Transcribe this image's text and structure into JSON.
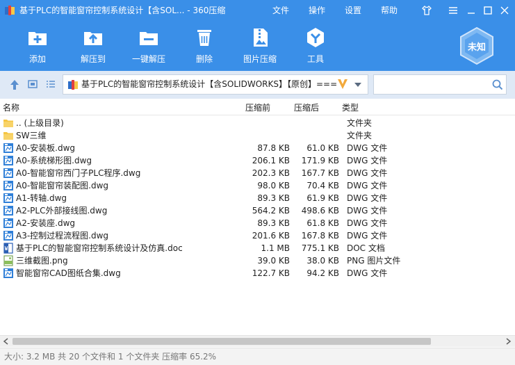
{
  "window": {
    "title": "基于PLC的智能窗帘控制系统设计【含SOL... - 360压缩",
    "menu": [
      "文件",
      "操作",
      "设置",
      "帮助"
    ]
  },
  "toolbar": {
    "buttons": [
      {
        "label": "添加",
        "icon": "add-icon"
      },
      {
        "label": "解压到",
        "icon": "extract-to-icon"
      },
      {
        "label": "一键解压",
        "icon": "one-click-extract-icon"
      },
      {
        "label": "删除",
        "icon": "delete-icon"
      },
      {
        "label": "图片压缩",
        "icon": "image-compress-icon"
      },
      {
        "label": "工具",
        "icon": "tools-icon"
      }
    ],
    "badge": "未知"
  },
  "address": {
    "path": "基于PLC的智能窗帘控制系统设计【含SOLIDWORKS】【原创】===",
    "search_placeholder": ""
  },
  "columns": [
    "名称",
    "压缩前",
    "压缩后",
    "类型"
  ],
  "files": [
    {
      "name": ".. (上级目录)",
      "orig": "",
      "comp": "",
      "type": "文件夹",
      "kind": "folder"
    },
    {
      "name": "SW三维",
      "orig": "",
      "comp": "",
      "type": "文件夹",
      "kind": "folder"
    },
    {
      "name": "A0-安装板.dwg",
      "orig": "87.8 KB",
      "comp": "61.0 KB",
      "type": "DWG 文件",
      "kind": "dwg"
    },
    {
      "name": "A0-系统梯形图.dwg",
      "orig": "206.1 KB",
      "comp": "171.9 KB",
      "type": "DWG 文件",
      "kind": "dwg"
    },
    {
      "name": "A0-智能窗帘西门子PLC程序.dwg",
      "orig": "202.3 KB",
      "comp": "167.7 KB",
      "type": "DWG 文件",
      "kind": "dwg"
    },
    {
      "name": "A0-智能窗帘装配图.dwg",
      "orig": "98.0 KB",
      "comp": "70.4 KB",
      "type": "DWG 文件",
      "kind": "dwg"
    },
    {
      "name": "A1-转轴.dwg",
      "orig": "89.3 KB",
      "comp": "61.9 KB",
      "type": "DWG 文件",
      "kind": "dwg"
    },
    {
      "name": "A2-PLC外部接线图.dwg",
      "orig": "564.2 KB",
      "comp": "498.6 KB",
      "type": "DWG 文件",
      "kind": "dwg"
    },
    {
      "name": "A2-安装座.dwg",
      "orig": "89.3 KB",
      "comp": "61.8 KB",
      "type": "DWG 文件",
      "kind": "dwg"
    },
    {
      "name": "A3-控制过程流程图.dwg",
      "orig": "201.6 KB",
      "comp": "167.8 KB",
      "type": "DWG 文件",
      "kind": "dwg"
    },
    {
      "name": "基于PLC的智能窗帘控制系统设计及仿真.doc",
      "orig": "1.1 MB",
      "comp": "775.1 KB",
      "type": "DOC 文档",
      "kind": "doc"
    },
    {
      "name": "三维截图.png",
      "orig": "39.0 KB",
      "comp": "38.0 KB",
      "type": "PNG 图片文件",
      "kind": "png"
    },
    {
      "name": "智能窗帘CAD图纸合集.dwg",
      "orig": "122.7 KB",
      "comp": "94.2 KB",
      "type": "DWG 文件",
      "kind": "dwg"
    }
  ],
  "status": "大小: 3.2 MB 共 20 个文件和 1 个文件夹 压缩率 65.2%",
  "colors": {
    "accent": "#3a8fe8",
    "address_bar": "#dfe9f6",
    "folder": "#f5c542",
    "dwg": "#2f7fd8"
  }
}
